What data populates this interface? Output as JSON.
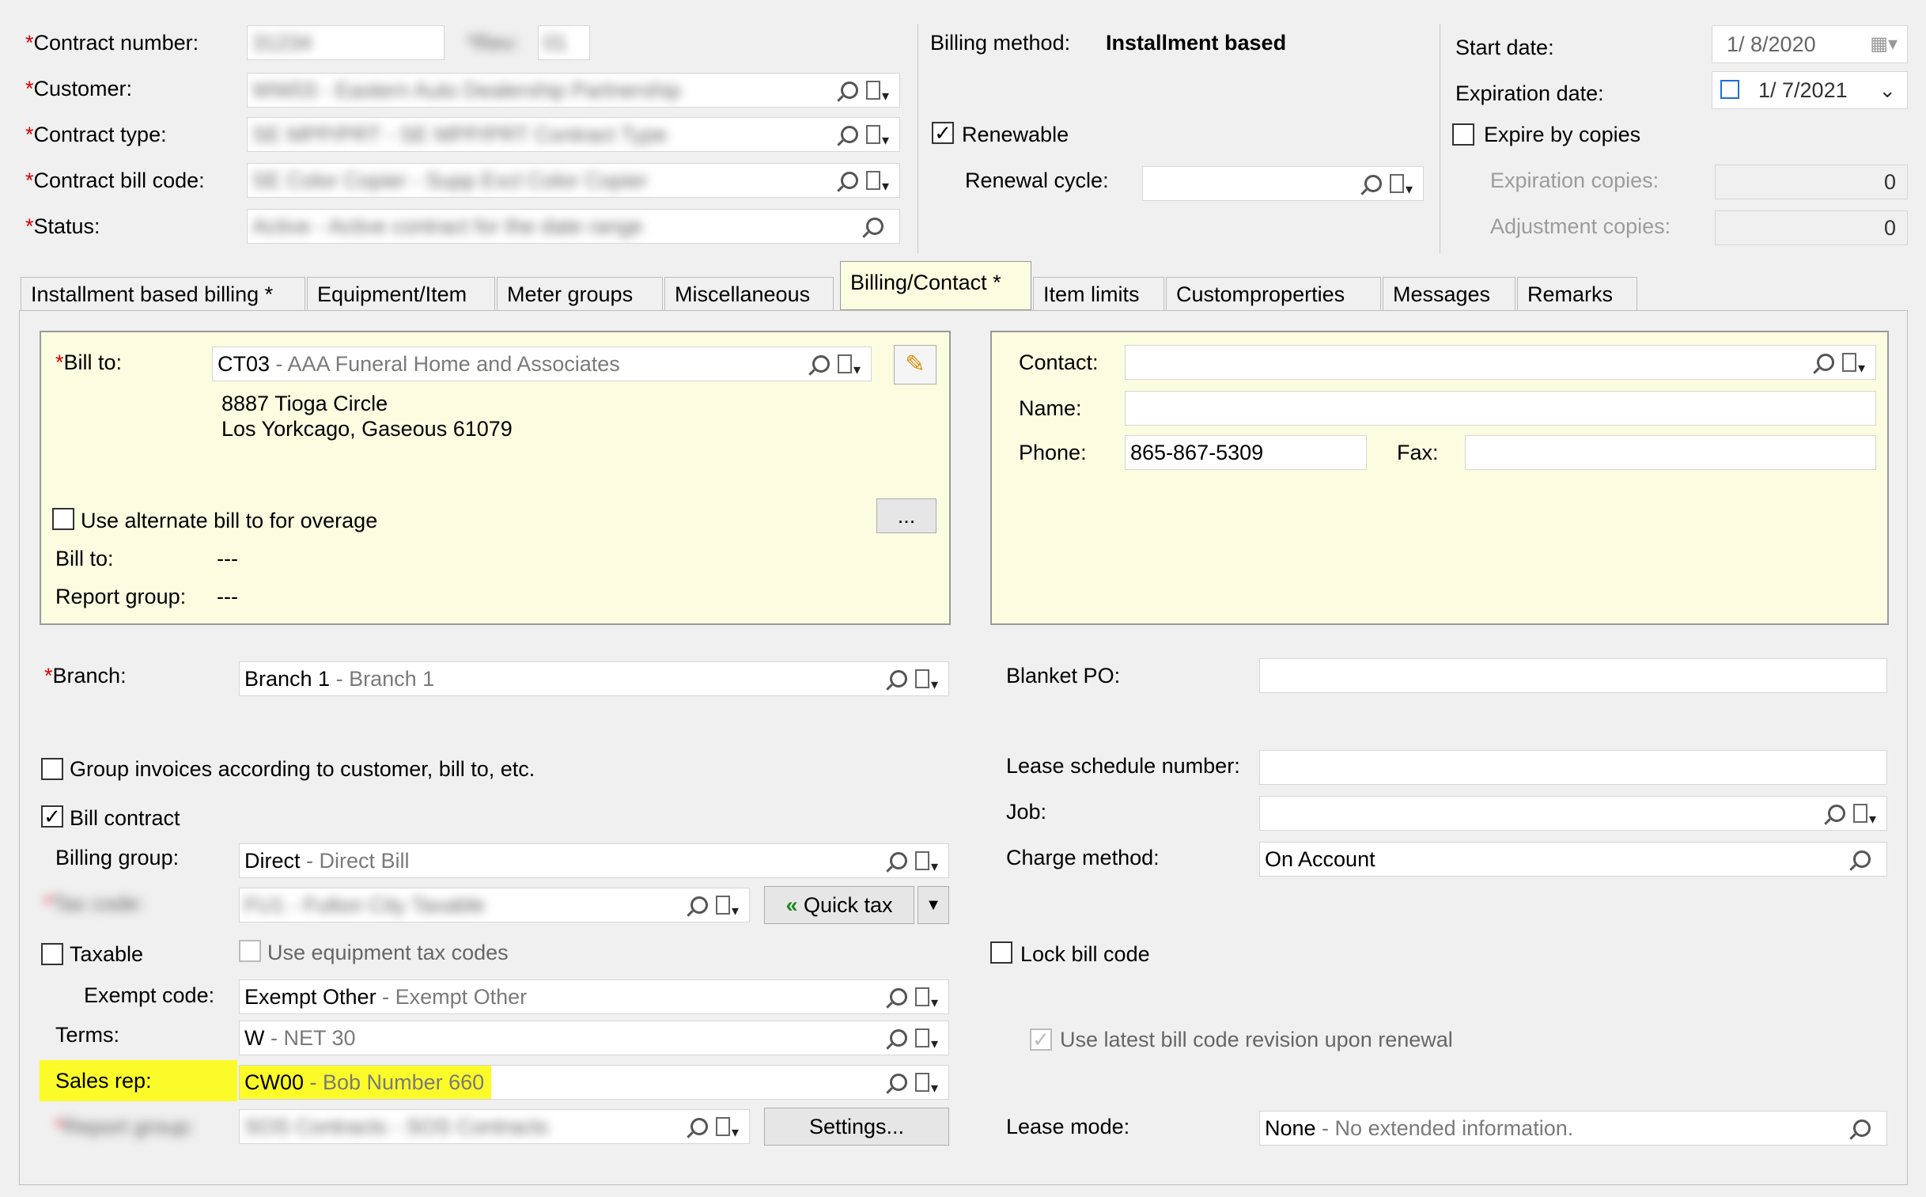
{
  "header": {
    "contract_number": {
      "label": "Contract number:",
      "value": "31234",
      "rev_label": "*Rev:",
      "rev_value": "01"
    },
    "customer": {
      "label": "Customer:",
      "code": "WW03",
      "desc": "Eastern Auto Dealership Partnership"
    },
    "contract_type": {
      "label": "Contract type:",
      "code": "SE MPP/PRT",
      "desc": "SE MPP/PRT Contract Type"
    },
    "contract_bill_code": {
      "label": "Contract bill code:",
      "code": "SE Color Copier",
      "desc": "Supp Excl Color Copier"
    },
    "status": {
      "label": "Status:",
      "code": "Active",
      "desc": "Active contract for the date range"
    },
    "billing_method_label": "Billing method:",
    "billing_method_value": "Installment based",
    "renewable_label": "Renewable",
    "renewal_cycle_label": "Renewal cycle:",
    "start_date_label": "Start date:",
    "start_date_value": "1/ 8/2020",
    "expiration_date_label": "Expiration date:",
    "expiration_date_value": "1/ 7/2021",
    "expire_by_copies_label": "Expire by copies",
    "expiration_copies_label": "Expiration copies:",
    "expiration_copies_value": "0",
    "adjustment_copies_label": "Adjustment copies:",
    "adjustment_copies_value": "0",
    "required_mark": "*"
  },
  "tabs": [
    "Installment based billing *",
    "Equipment/Item",
    "Meter groups",
    "Miscellaneous",
    "Billing/Contact *",
    "Item limits",
    "Customproperties",
    "Messages",
    "Remarks"
  ],
  "billto": {
    "label": "Bill to:",
    "code": "CT03",
    "desc": "AAA Funeral Home and Associates",
    "address1": "8887 Tioga Circle",
    "address2": "Los Yorkcago, Gaseous 61079",
    "alt_label": "Use alternate bill to for overage",
    "ellipsis": "...",
    "billto2_label": "Bill to:",
    "billto2_value": "---",
    "report_group_label": "Report group:",
    "report_group_value": "---"
  },
  "contact": {
    "contact_label": "Contact:",
    "name_label": "Name:",
    "phone_label": "Phone:",
    "phone_value": "865-867-5309",
    "fax_label": "Fax:"
  },
  "lower_left": {
    "branch_label": "Branch:",
    "branch_code": "Branch 1",
    "branch_desc": "Branch 1",
    "group_invoices_label": "Group invoices according to customer, bill to, etc.",
    "bill_contract_label": "Bill contract",
    "billing_group_label": "Billing group:",
    "billing_group_code": "Direct",
    "billing_group_desc": "Direct Bill",
    "tax_code_label": "Tax code:",
    "tax_code_code": "FU1",
    "tax_code_desc": "Fulton City Taxable",
    "quick_tax": "Quick tax",
    "taxable_label": "Taxable",
    "use_equipment_tax_label": "Use equipment tax codes",
    "exempt_code_label": "Exempt code:",
    "exempt_code_code": "Exempt Other",
    "exempt_code_desc": "Exempt Other",
    "terms_label": "Terms:",
    "terms_code": "W",
    "terms_desc": "NET 30",
    "sales_rep_label": "Sales rep:",
    "sales_rep_code": "CW00",
    "sales_rep_desc": "Bob Number 660",
    "report_group_label": "Report group:",
    "report_group_code": "SOS Contracts",
    "report_group_desc": "SOS Contracts",
    "settings": "Settings..."
  },
  "lower_right": {
    "blanket_po_label": "Blanket PO:",
    "lease_schedule_label": "Lease schedule number:",
    "job_label": "Job:",
    "charge_method_label": "Charge method:",
    "charge_method_value": "On Account",
    "lock_bill_code_label": "Lock bill code",
    "use_latest_label": "Use latest bill code revision upon renewal",
    "lease_mode_label": "Lease mode:",
    "lease_mode_code": "None",
    "lease_mode_desc": "No extended information."
  },
  "colors": {
    "highlight": "#fbfb2a",
    "panel": "#fcfce0",
    "required": "#dd0000"
  }
}
